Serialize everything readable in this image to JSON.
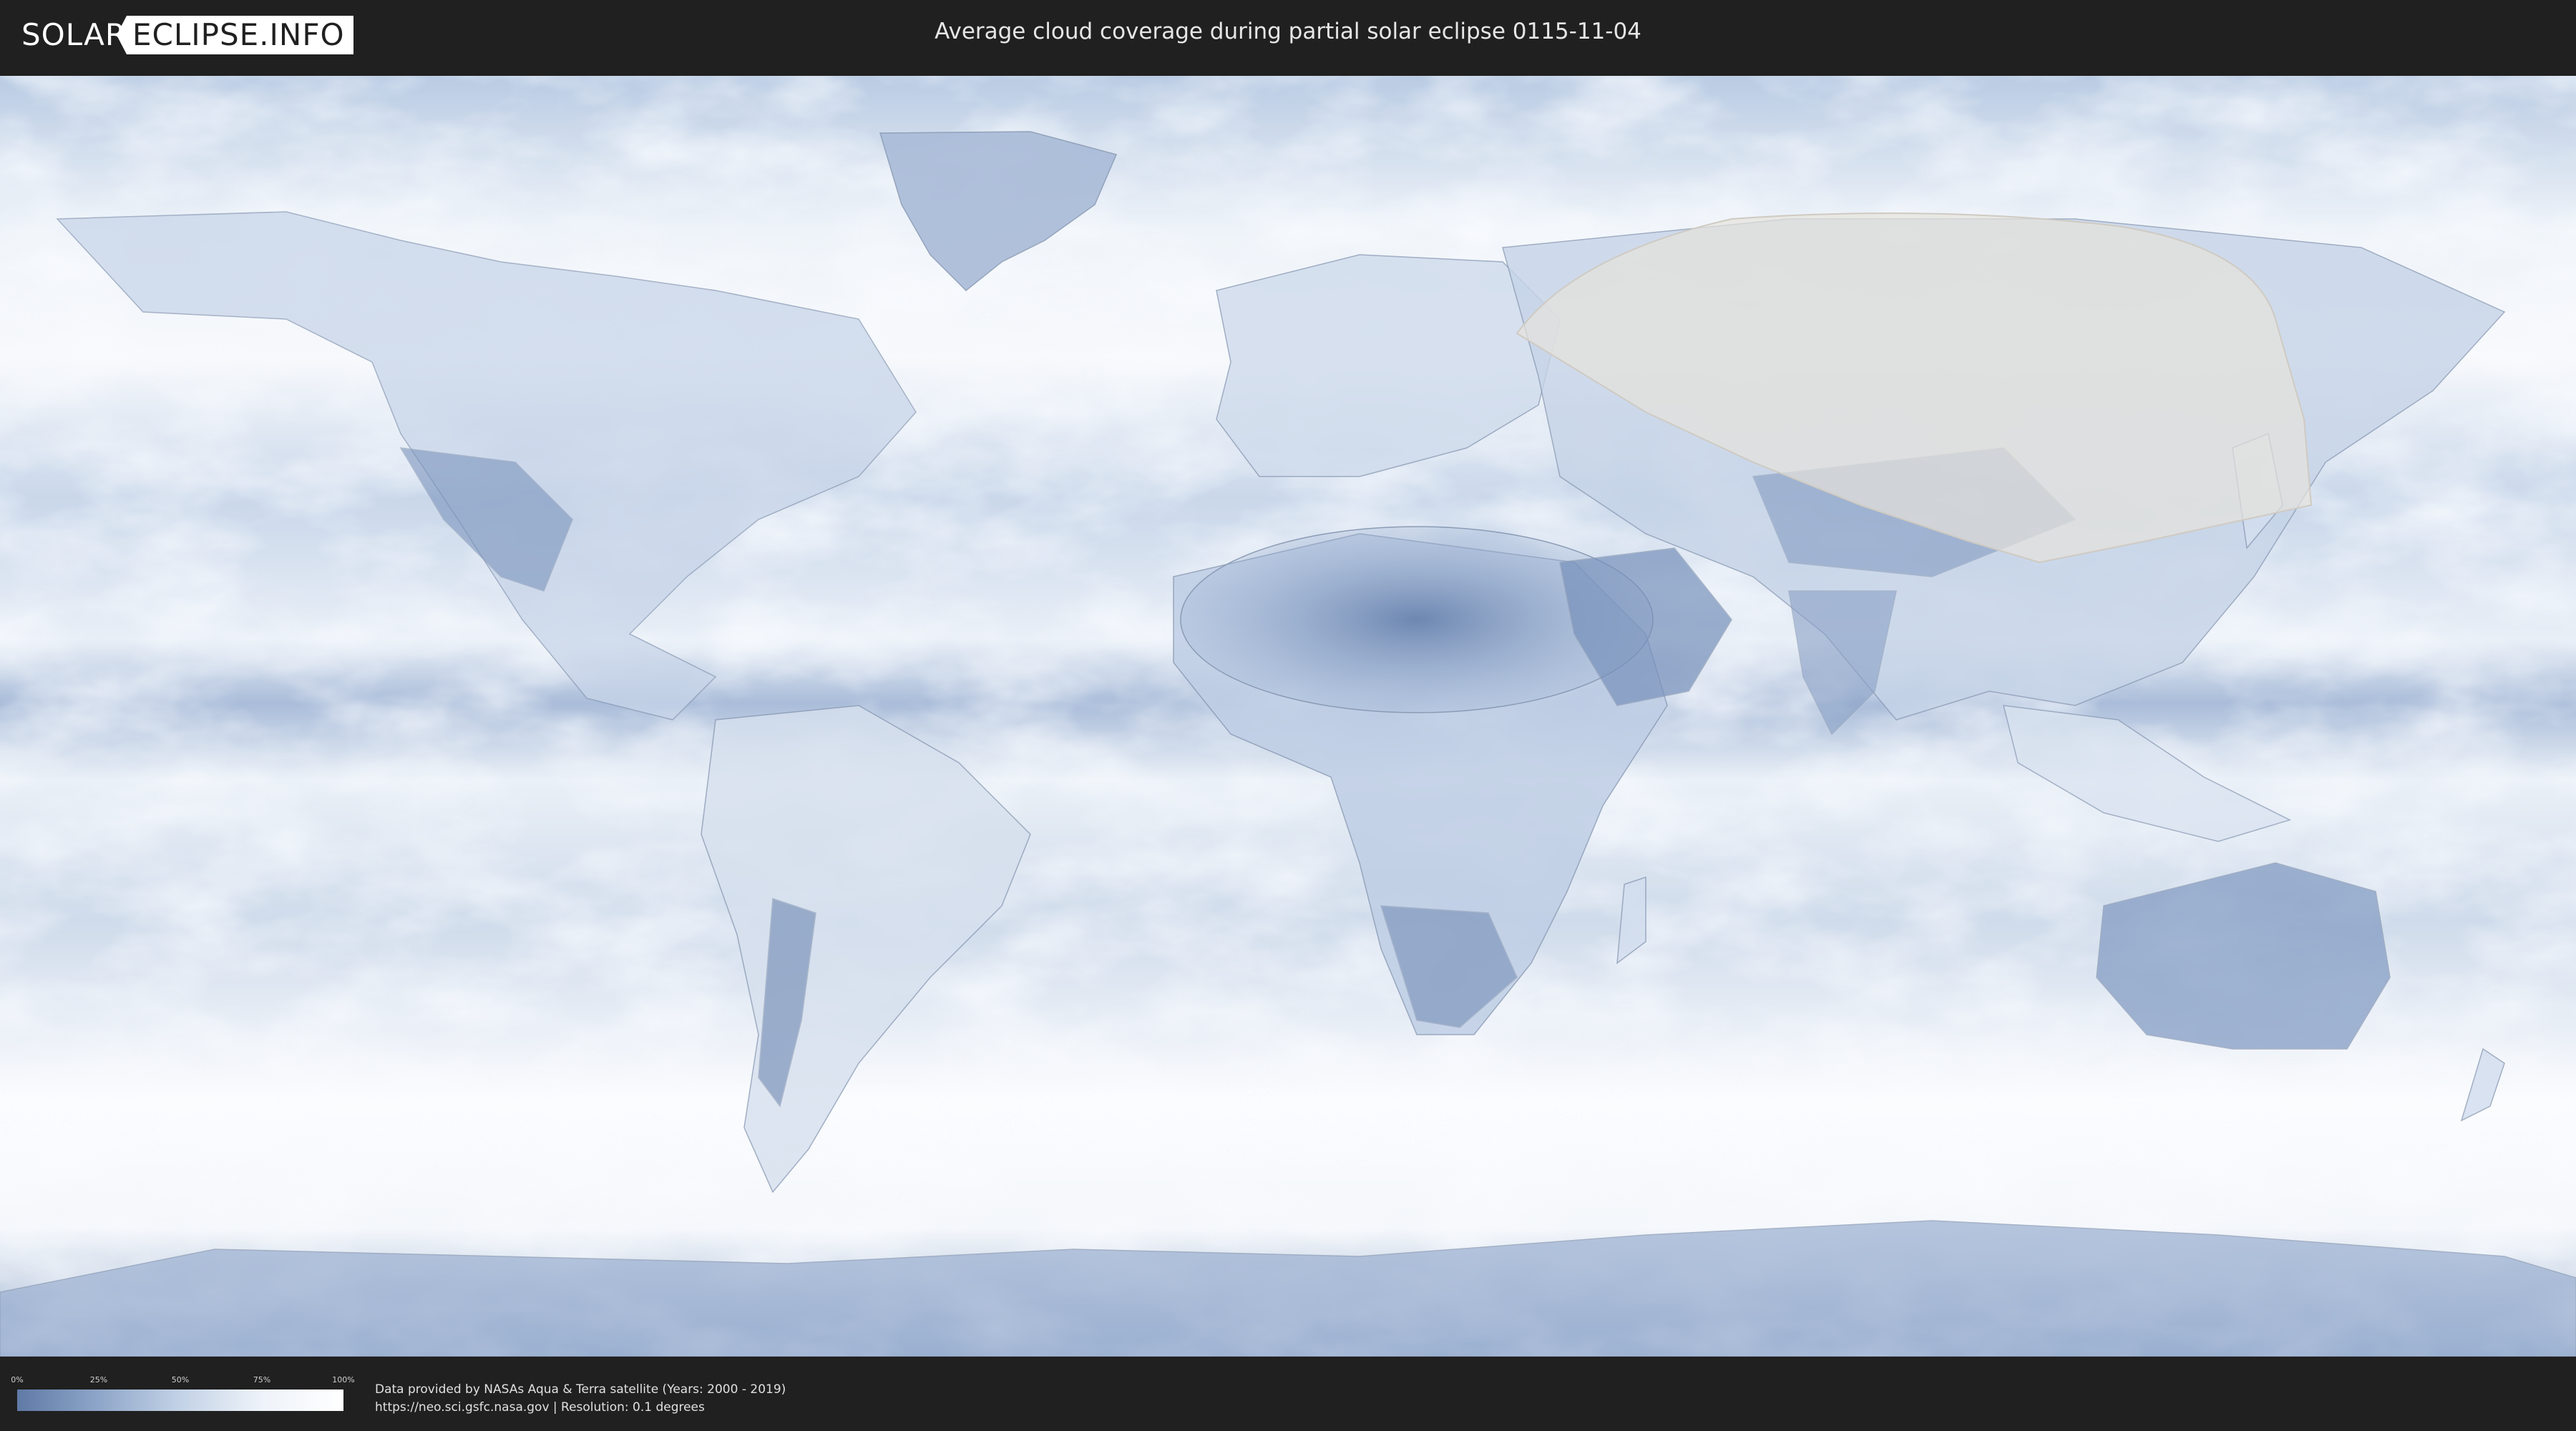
{
  "header": {
    "logo_left": "SOLAR",
    "logo_right": "ECLIPSE.INFO",
    "title": "Average cloud coverage during partial solar eclipse 0115-11-04"
  },
  "map": {
    "description_icon": "world-map",
    "colors": {
      "clear": "#5f7aa6",
      "cloudy": "#ffffff",
      "eclipse_zone": "#e6e2dc"
    }
  },
  "legend": {
    "ticks": [
      "0%",
      "25%",
      "50%",
      "75%",
      "100%"
    ]
  },
  "footer": {
    "line1": "Data provided by NASAs Aqua & Terra satellite (Years: 2000 - 2019)",
    "line2": "https://neo.sci.gsfc.nasa.gov | Resolution: 0.1 degrees"
  }
}
